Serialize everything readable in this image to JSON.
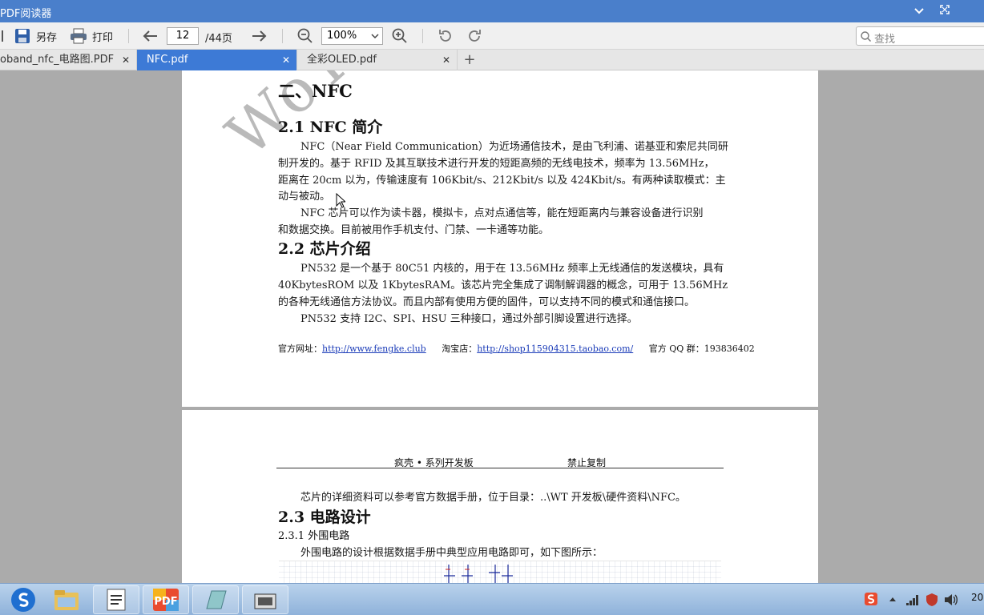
{
  "window": {
    "title": "PDF阅读器"
  },
  "toolbar": {
    "save_as_label": "另存",
    "print_label": "打印",
    "page_current": "12",
    "page_total": "/44页",
    "zoom_value": "100%",
    "search_placeholder": "查找"
  },
  "tabs": [
    {
      "label": "oband_nfc_电路图.PDF",
      "active": false
    },
    {
      "label": "NFC.pdf",
      "active": true
    },
    {
      "label": "全彩OLED.pdf",
      "active": false
    }
  ],
  "tab_close_glyph": "✕",
  "tab_add_glyph": "+",
  "page1": {
    "watermark": "WoTv",
    "heading_main": "二、NFC",
    "section_2_1": "2.1 NFC 简介",
    "para_2_1_a": [
      "NFC（Near Field Communication）为近场通信技术，是由飞利浦、诺基亚和索尼共同研",
      "制开发的。基于 RFID 及其互联技术进行开发的短距高频的无线电技术，频率为 13.56MHz，",
      "距离在 20cm 以为，传输速度有 106Kbit/s、212Kbit/s 以及 424Kbit/s。有两种读取模式：主",
      "动与被动。"
    ],
    "para_2_1_b": [
      "NFC 芯片可以作为读卡器，模拟卡，点对点通信等，能在短距离内与兼容设备进行识别",
      "和数据交换。目前被用作手机支付、门禁、一卡通等功能。"
    ],
    "section_2_2": "2.2 芯片介绍",
    "para_2_2_a": [
      "PN532 是一个基于 80C51 内核的，用于在 13.56MHz 频率上无线通信的发送模块，具有",
      "40KbytesROM 以及 1KbytesRAM。该芯片完全集成了调制解调器的概念，可用于 13.56MHz",
      "的各种无线通信方法协议。而且内部有使用方便的固件，可以支持不同的模式和通信接口。"
    ],
    "para_2_2_b": "PN532 支持 I2C、SPI、HSU 三种接口，通过外部引脚设置进行选择。",
    "footer": {
      "site_label": "官方网址：",
      "site_url": "http://www.fengke.club",
      "shop_label": "淘宝店：",
      "shop_url": "http://shop115904315.taobao.com/",
      "qq_label": "官方 QQ 群：193836402"
    }
  },
  "page2": {
    "header_left": "疯壳 • 系列开发板",
    "header_right": "禁止复制",
    "para_intro": "芯片的详细资料可以参考官方数据手册，位于目录：..\\WT 开发板\\硬件资料\\NFC。",
    "section_2_3": "2.3 电路设计",
    "subsection_2_3_1": "2.3.1  外围电路",
    "para_2_3_1": "外围电路的设计根据数据手册中典型应用电路即可，如下图所示："
  },
  "taskbar": {
    "clock_partial": "20",
    "apps": [
      "sogou-browser",
      "file-explorer",
      "notepad",
      "pdf-reader",
      "paint",
      "microsoft-app"
    ]
  },
  "colors": {
    "titlebar": "#4a7fcb",
    "active_tab": "#3d7ad6",
    "link": "#1a3bb8"
  }
}
